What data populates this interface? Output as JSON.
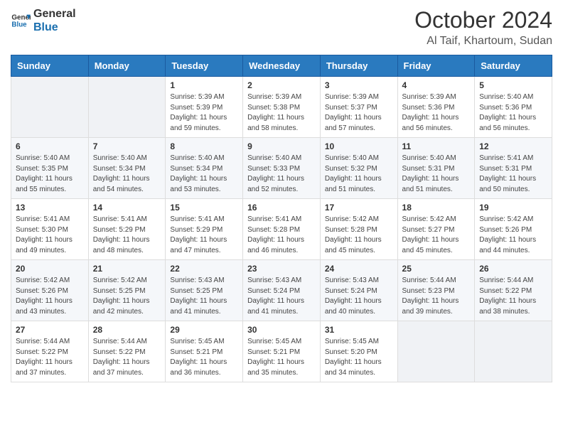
{
  "logo": {
    "line1": "General",
    "line2": "Blue"
  },
  "header": {
    "month": "October 2024",
    "location": "Al Taif, Khartoum, Sudan"
  },
  "columns": [
    "Sunday",
    "Monday",
    "Tuesday",
    "Wednesday",
    "Thursday",
    "Friday",
    "Saturday"
  ],
  "weeks": [
    [
      {
        "day": "",
        "info": ""
      },
      {
        "day": "",
        "info": ""
      },
      {
        "day": "1",
        "info": "Sunrise: 5:39 AM\nSunset: 5:39 PM\nDaylight: 11 hours and 59 minutes."
      },
      {
        "day": "2",
        "info": "Sunrise: 5:39 AM\nSunset: 5:38 PM\nDaylight: 11 hours and 58 minutes."
      },
      {
        "day": "3",
        "info": "Sunrise: 5:39 AM\nSunset: 5:37 PM\nDaylight: 11 hours and 57 minutes."
      },
      {
        "day": "4",
        "info": "Sunrise: 5:39 AM\nSunset: 5:36 PM\nDaylight: 11 hours and 56 minutes."
      },
      {
        "day": "5",
        "info": "Sunrise: 5:40 AM\nSunset: 5:36 PM\nDaylight: 11 hours and 56 minutes."
      }
    ],
    [
      {
        "day": "6",
        "info": "Sunrise: 5:40 AM\nSunset: 5:35 PM\nDaylight: 11 hours and 55 minutes."
      },
      {
        "day": "7",
        "info": "Sunrise: 5:40 AM\nSunset: 5:34 PM\nDaylight: 11 hours and 54 minutes."
      },
      {
        "day": "8",
        "info": "Sunrise: 5:40 AM\nSunset: 5:34 PM\nDaylight: 11 hours and 53 minutes."
      },
      {
        "day": "9",
        "info": "Sunrise: 5:40 AM\nSunset: 5:33 PM\nDaylight: 11 hours and 52 minutes."
      },
      {
        "day": "10",
        "info": "Sunrise: 5:40 AM\nSunset: 5:32 PM\nDaylight: 11 hours and 51 minutes."
      },
      {
        "day": "11",
        "info": "Sunrise: 5:40 AM\nSunset: 5:31 PM\nDaylight: 11 hours and 51 minutes."
      },
      {
        "day": "12",
        "info": "Sunrise: 5:41 AM\nSunset: 5:31 PM\nDaylight: 11 hours and 50 minutes."
      }
    ],
    [
      {
        "day": "13",
        "info": "Sunrise: 5:41 AM\nSunset: 5:30 PM\nDaylight: 11 hours and 49 minutes."
      },
      {
        "day": "14",
        "info": "Sunrise: 5:41 AM\nSunset: 5:29 PM\nDaylight: 11 hours and 48 minutes."
      },
      {
        "day": "15",
        "info": "Sunrise: 5:41 AM\nSunset: 5:29 PM\nDaylight: 11 hours and 47 minutes."
      },
      {
        "day": "16",
        "info": "Sunrise: 5:41 AM\nSunset: 5:28 PM\nDaylight: 11 hours and 46 minutes."
      },
      {
        "day": "17",
        "info": "Sunrise: 5:42 AM\nSunset: 5:28 PM\nDaylight: 11 hours and 45 minutes."
      },
      {
        "day": "18",
        "info": "Sunrise: 5:42 AM\nSunset: 5:27 PM\nDaylight: 11 hours and 45 minutes."
      },
      {
        "day": "19",
        "info": "Sunrise: 5:42 AM\nSunset: 5:26 PM\nDaylight: 11 hours and 44 minutes."
      }
    ],
    [
      {
        "day": "20",
        "info": "Sunrise: 5:42 AM\nSunset: 5:26 PM\nDaylight: 11 hours and 43 minutes."
      },
      {
        "day": "21",
        "info": "Sunrise: 5:42 AM\nSunset: 5:25 PM\nDaylight: 11 hours and 42 minutes."
      },
      {
        "day": "22",
        "info": "Sunrise: 5:43 AM\nSunset: 5:25 PM\nDaylight: 11 hours and 41 minutes."
      },
      {
        "day": "23",
        "info": "Sunrise: 5:43 AM\nSunset: 5:24 PM\nDaylight: 11 hours and 41 minutes."
      },
      {
        "day": "24",
        "info": "Sunrise: 5:43 AM\nSunset: 5:24 PM\nDaylight: 11 hours and 40 minutes."
      },
      {
        "day": "25",
        "info": "Sunrise: 5:44 AM\nSunset: 5:23 PM\nDaylight: 11 hours and 39 minutes."
      },
      {
        "day": "26",
        "info": "Sunrise: 5:44 AM\nSunset: 5:22 PM\nDaylight: 11 hours and 38 minutes."
      }
    ],
    [
      {
        "day": "27",
        "info": "Sunrise: 5:44 AM\nSunset: 5:22 PM\nDaylight: 11 hours and 37 minutes."
      },
      {
        "day": "28",
        "info": "Sunrise: 5:44 AM\nSunset: 5:22 PM\nDaylight: 11 hours and 37 minutes."
      },
      {
        "day": "29",
        "info": "Sunrise: 5:45 AM\nSunset: 5:21 PM\nDaylight: 11 hours and 36 minutes."
      },
      {
        "day": "30",
        "info": "Sunrise: 5:45 AM\nSunset: 5:21 PM\nDaylight: 11 hours and 35 minutes."
      },
      {
        "day": "31",
        "info": "Sunrise: 5:45 AM\nSunset: 5:20 PM\nDaylight: 11 hours and 34 minutes."
      },
      {
        "day": "",
        "info": ""
      },
      {
        "day": "",
        "info": ""
      }
    ]
  ]
}
